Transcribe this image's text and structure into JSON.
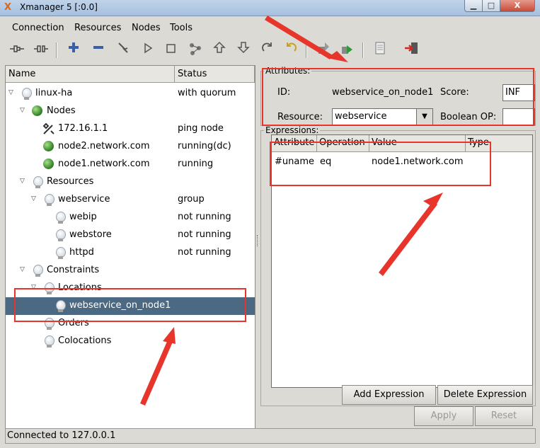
{
  "window": {
    "title": "Xmanager 5 [:0.0]",
    "app_icon": "X",
    "min_icon": "minimize-icon",
    "max_icon": "maximize-icon",
    "close_label": "X"
  },
  "menubar": {
    "items": [
      "Connection",
      "Resources",
      "Nodes",
      "Tools"
    ]
  },
  "toolbar": {
    "icons": [
      "connect-icon",
      "disconnect-icon",
      "add-icon",
      "remove-icon",
      "cleanup-icon",
      "play-icon",
      "stop-icon",
      "migrate-icon",
      "move-up-icon",
      "move-down-icon",
      "redo-icon",
      "undo-icon",
      "standby-icon",
      "active-icon",
      "log-icon",
      "exit-icon"
    ]
  },
  "tree": {
    "headers": {
      "name": "Name",
      "status": "Status"
    },
    "rows": [
      {
        "label": "linux-ha",
        "status": "with quorum"
      },
      {
        "label": "Nodes",
        "status": ""
      },
      {
        "label": "172.16.1.1",
        "status": "ping node"
      },
      {
        "label": "node2.network.com",
        "status": "running(dc)"
      },
      {
        "label": "node1.network.com",
        "status": "running"
      },
      {
        "label": "Resources",
        "status": ""
      },
      {
        "label": "webservice",
        "status": "group"
      },
      {
        "label": "webip",
        "status": "not running"
      },
      {
        "label": "webstore",
        "status": "not running"
      },
      {
        "label": "httpd",
        "status": "not running"
      },
      {
        "label": "Constraints",
        "status": ""
      },
      {
        "label": "Locations",
        "status": ""
      },
      {
        "label": "webservice_on_node1",
        "status": ""
      },
      {
        "label": "Orders",
        "status": ""
      },
      {
        "label": "Colocations",
        "status": ""
      }
    ]
  },
  "attributes": {
    "group_title": "Attributes:",
    "id_label": "ID:",
    "id_value": "webservice_on_node1",
    "score_label": "Score:",
    "score_value": "INF",
    "resource_label": "Resource:",
    "resource_value": "webservice",
    "boolean_label": "Boolean OP:",
    "boolean_value": ""
  },
  "expressions": {
    "group_title": "Expressions:",
    "headers": [
      "Attribute",
      "Operation",
      "Value",
      "Type"
    ],
    "rows": [
      {
        "attribute": "#uname",
        "operation": "eq",
        "value": "node1.network.com",
        "type": ""
      }
    ],
    "add_button": "Add Expression",
    "delete_button": "Delete Expression"
  },
  "actions": {
    "apply": "Apply",
    "reset": "Reset"
  },
  "status": {
    "text": "Connected to 127.0.0.1"
  },
  "annotation_color": "#e8352c"
}
